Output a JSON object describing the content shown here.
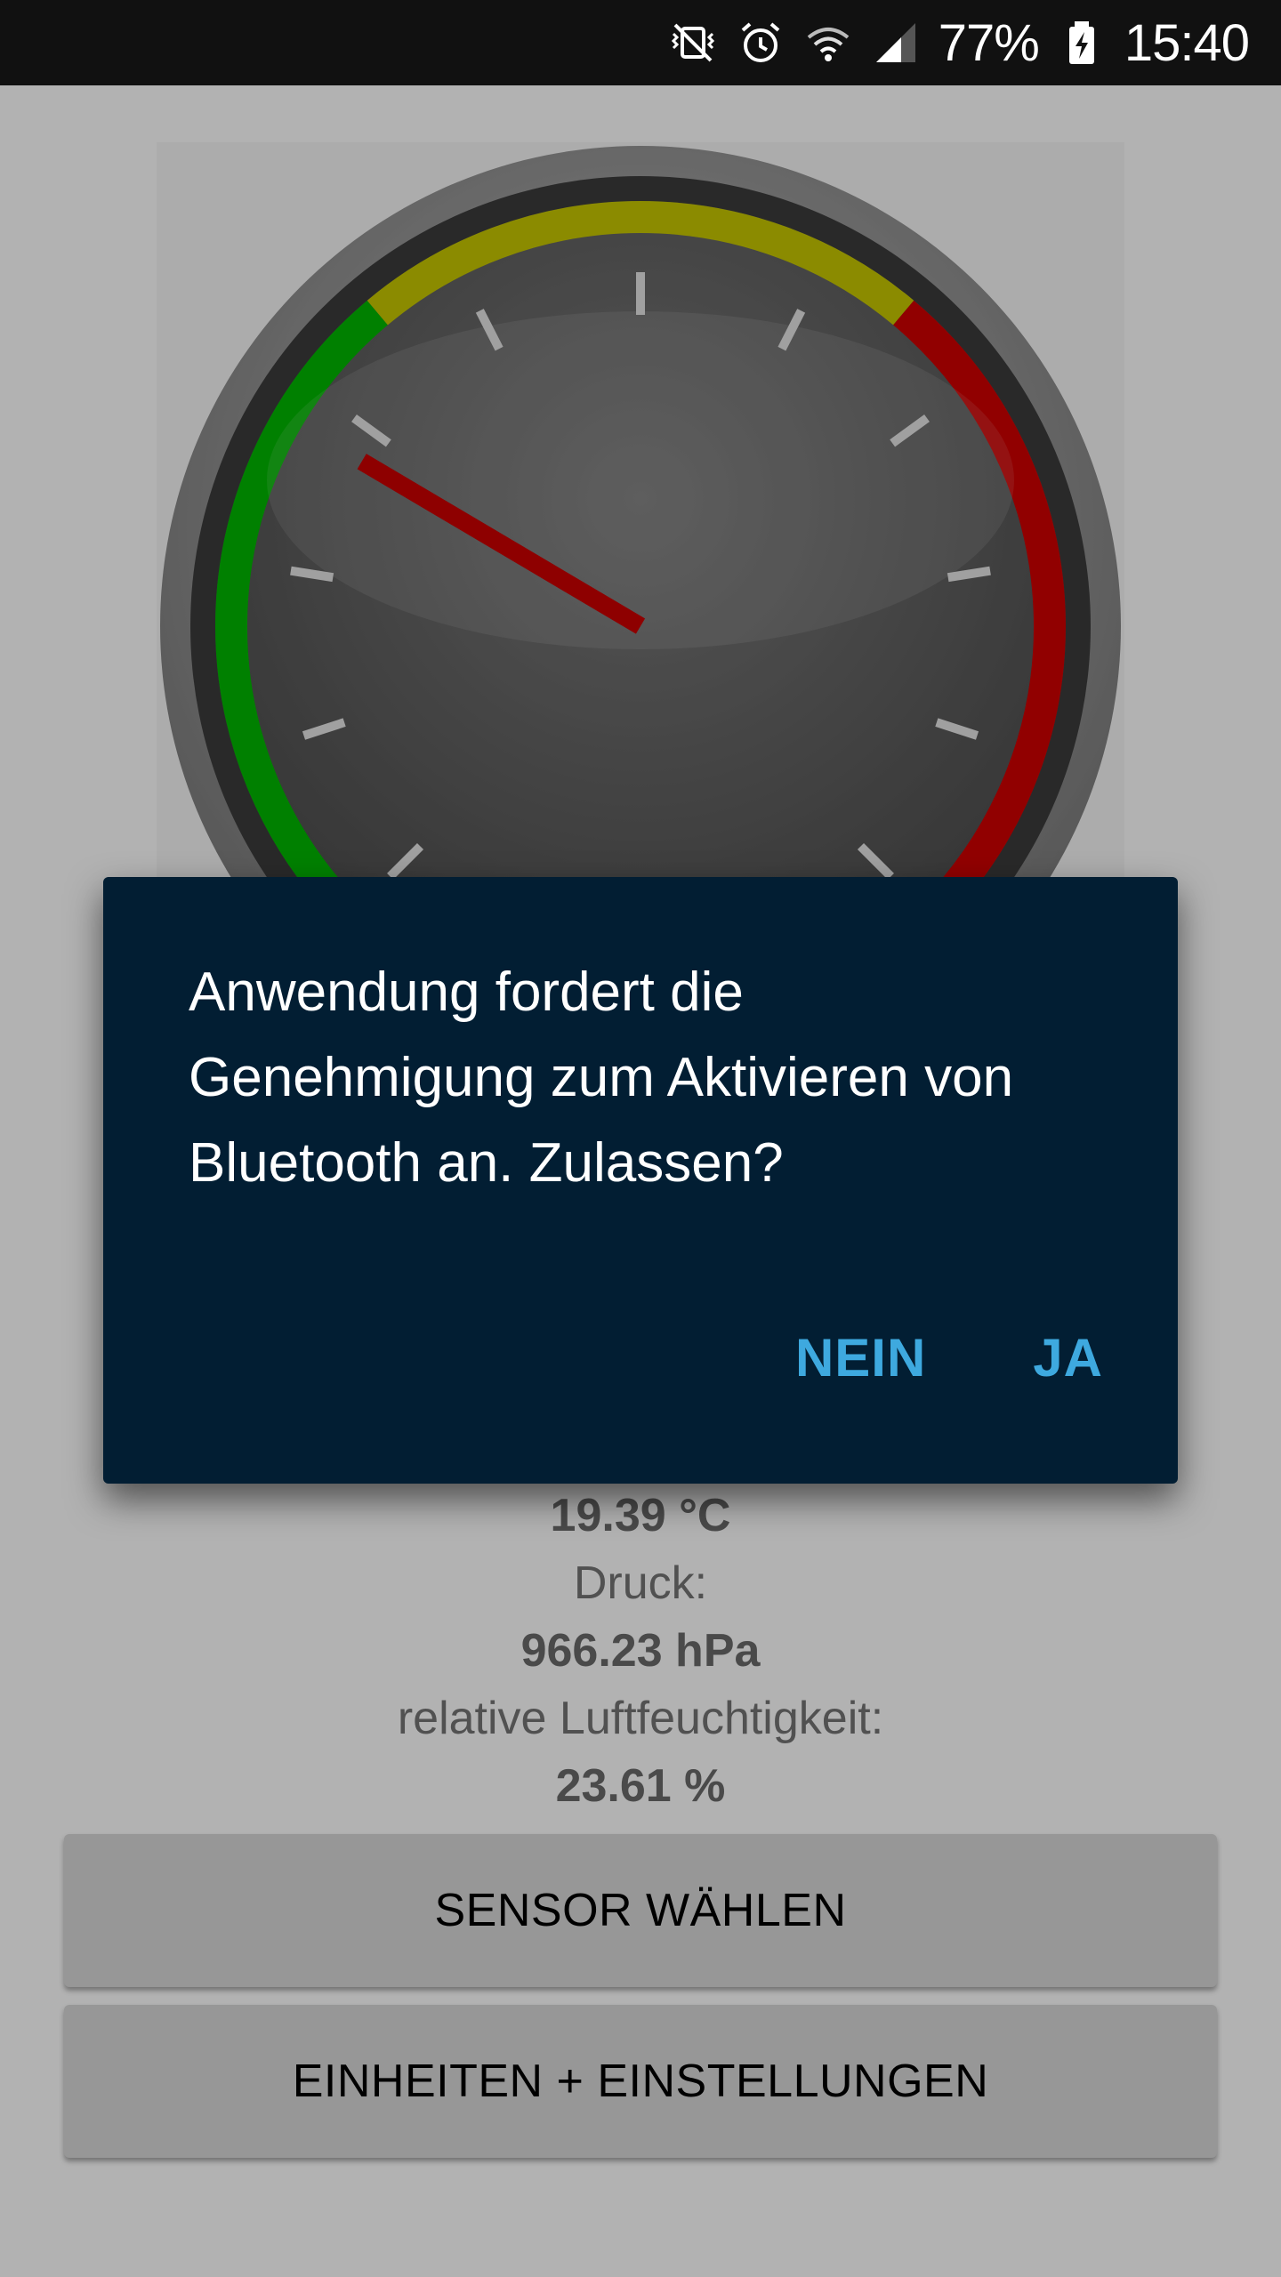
{
  "status_bar": {
    "battery": "77%",
    "time": "15:40",
    "icons": [
      "vibrate-mute-icon",
      "alarm-icon",
      "wifi-icon",
      "cell-signal-icon",
      "battery-charging-icon"
    ]
  },
  "gauge": {
    "needle_level": 0.28,
    "zone_colors": {
      "low": "#00b800",
      "mid": "#c8c800",
      "high": "#d00000"
    },
    "needle_color": "#cc0000"
  },
  "readings": {
    "temperature_value": "19.39 °C",
    "pressure_label": "Druck:",
    "pressure_value": "966.23 hPa",
    "humidity_label": "relative Luftfeuchtigkeit:",
    "humidity_value": "23.61 %"
  },
  "buttons": {
    "sensor": "SENSOR WÄHLEN",
    "settings": "EINHEITEN + EINSTELLUNGEN"
  },
  "dialog": {
    "line1": "Anwendung fordert die",
    "line2": "Genehmigung zum Aktivieren von",
    "line3": "Bluetooth an. Zulassen?",
    "deny": "NEIN",
    "allow": "JA",
    "background": "#021e33",
    "accent": "#3ea9df"
  }
}
